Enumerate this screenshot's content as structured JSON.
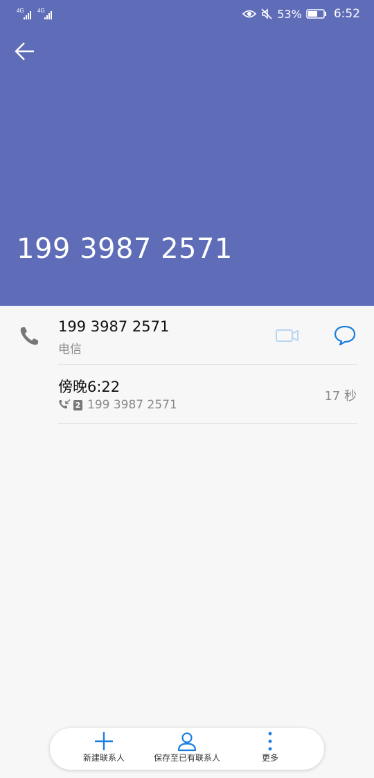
{
  "status_bar": {
    "signal1_label": "4G",
    "signal2_label": "4G",
    "battery_percent": "53%",
    "time": "6:52",
    "icons": [
      "eye-icon",
      "mute-icon",
      "battery-icon"
    ]
  },
  "header": {
    "phone_number": "199 3987 2571",
    "background_color": "#5f6db9"
  },
  "contact_row": {
    "number": "199 3987 2571",
    "carrier": "电信",
    "icons": [
      "phone-icon",
      "video-call-icon",
      "message-icon"
    ],
    "accent_color": "#1a7de0"
  },
  "call_log": [
    {
      "time": "傍晚6:22",
      "sim": "2",
      "number": "199 3987 2571",
      "duration": "17 秒",
      "icon": "outgoing-call-icon"
    }
  ],
  "bottom_bar": {
    "new_contact": "新建联系人",
    "save_to_existing": "保存至已有联系人",
    "more": "更多"
  }
}
